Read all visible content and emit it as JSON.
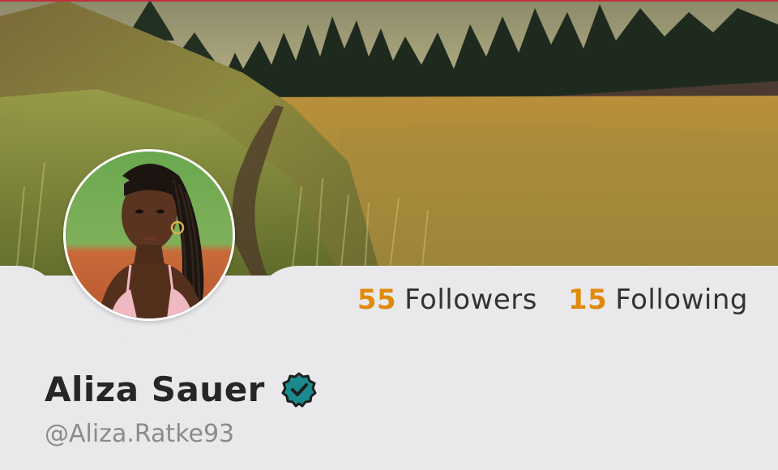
{
  "profile": {
    "name": "Aliza Sauer",
    "handle": "@Aliza.Ratke93",
    "verified": true
  },
  "stats": {
    "followers_count": "55",
    "followers_label": "Followers",
    "following_count": "15",
    "following_label": "Following"
  },
  "colors": {
    "accent": "#e08a0c",
    "verified_badge": "#1a8a8f",
    "background": "#e9e9eb",
    "top_rule": "#c0303a"
  },
  "icons": {
    "verified": "verified-check-icon"
  }
}
